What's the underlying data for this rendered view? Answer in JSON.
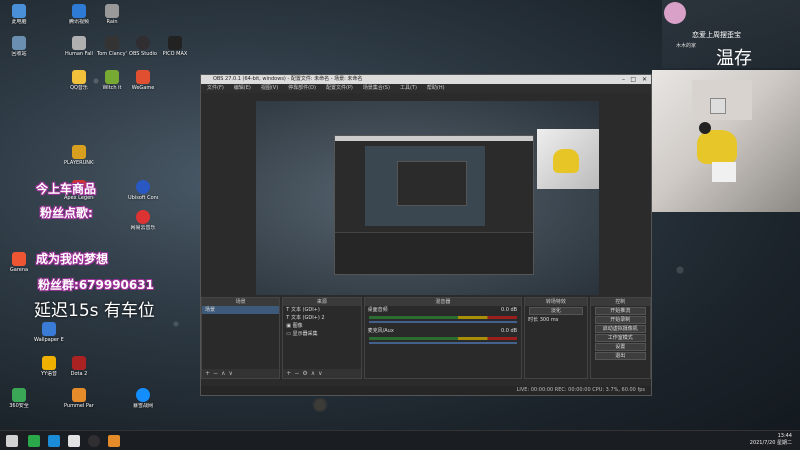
{
  "overlay": {
    "line1": "今上车商品",
    "line2": "粉丝点歌:",
    "line3": "成为我的梦想",
    "fan_label": "粉丝群:",
    "fan_number": "679990631",
    "delay_text": "延迟15s 有车位",
    "small_text": "我的帅哥在这里",
    "chinese_pinyin": "Tui Yu Shan Lao",
    "name": "温存",
    "name_top": "恋爱上周摆歪宝",
    "name_sub": "木木的家"
  },
  "desktop_icons": [
    {
      "label": "此电脑",
      "color": "#4a90d9"
    },
    {
      "label": "腾讯视频",
      "color": "#2e7bd6"
    },
    {
      "label": "Rain",
      "color": "#999"
    },
    {
      "label": "Tom Clancy's",
      "color": "#333"
    },
    {
      "label": "OBS Studio",
      "color": "#302e31"
    },
    {
      "label": "PICO MAX",
      "color": "#222"
    },
    {
      "label": "回收站",
      "color": "#6a8fb0"
    },
    {
      "label": "Human Fall",
      "color": "#b0b0b0"
    },
    {
      "label": "Witch it",
      "color": "#7a3"
    },
    {
      "label": "WeGame",
      "color": "#e05030"
    },
    {
      "label": "QQ音乐",
      "color": "#f2c13b"
    },
    {
      "label": "Apex Legends",
      "color": "#c33"
    },
    {
      "label": "PLAYERUNKNOWN",
      "color": "#d9a020"
    },
    {
      "label": "Ubisoft Connect",
      "color": "#2a58c2"
    },
    {
      "label": "网易云音乐",
      "color": "#d33"
    },
    {
      "label": "Garena",
      "color": "#e53"
    },
    {
      "label": "Wallpaper Engine",
      "color": "#3a7bd5"
    },
    {
      "label": "Dota 2",
      "color": "#a22"
    },
    {
      "label": "YY语音",
      "color": "#f0b000"
    },
    {
      "label": "360安全",
      "color": "#3aa757"
    },
    {
      "label": "暴雪战网",
      "color": "#148eff"
    },
    {
      "label": "Pummel Party",
      "color": "#e58b2a"
    }
  ],
  "obs": {
    "title": "OBS 27.0.1 (64-bit, windows) - 配置文件: 未命名 - 场景: 未命名",
    "menu": [
      "文件(F)",
      "编辑(E)",
      "视图(V)",
      "停靠部件(D)",
      "配置文件(P)",
      "场景集合(S)",
      "工具(T)",
      "帮助(H)"
    ],
    "panel_titles": {
      "scenes": "场景",
      "sources": "来源",
      "mixer": "混音器",
      "transitions": "转场特效",
      "controls": "控制"
    },
    "scene_items": [
      "场景"
    ],
    "source_items": [
      "文本 (GDI+)",
      "文本 (GDI+) 2",
      "图像",
      "显示器采集"
    ],
    "source_toolbar": {
      "properties": "属性",
      "filters": "滤镜"
    },
    "mixer_tracks": [
      {
        "name": "桌面音频",
        "level": "0.0 dB"
      },
      {
        "name": "麦克风/Aux",
        "level": "0.0 dB"
      }
    ],
    "transition": {
      "type": "淡化",
      "duration_label": "时长",
      "duration": "300 ms"
    },
    "controls": [
      "开始推流",
      "开始录制",
      "启动虚拟摄像机",
      "工作室模式",
      "设置",
      "退出"
    ],
    "status": "LIVE: 00:00:00   REC: 00:00:00   CPU: 3.7%, 60.00 fps"
  },
  "taskbar": {
    "time": "13:44",
    "date": "2021/7/20 星期二"
  }
}
